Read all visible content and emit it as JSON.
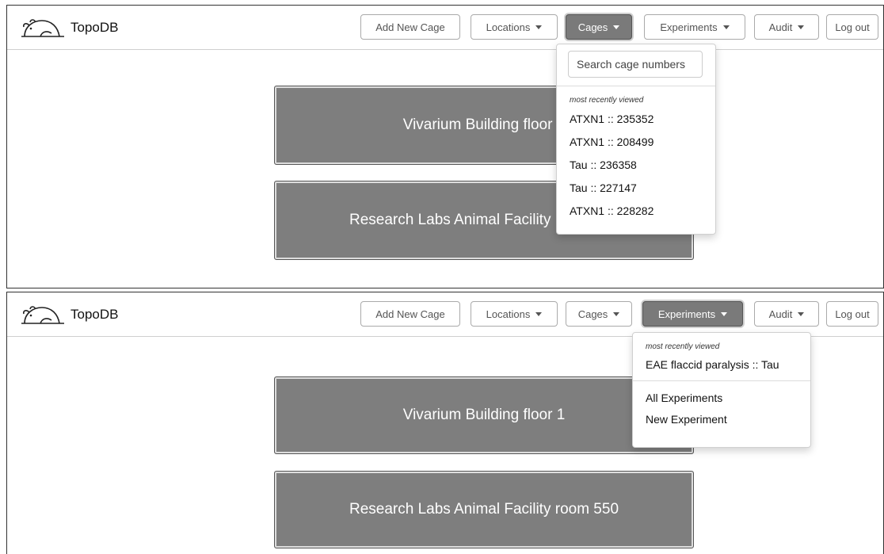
{
  "app": {
    "brand": "TopoDB"
  },
  "nav": {
    "add_new_cage": "Add New Cage",
    "locations": "Locations",
    "cages": "Cages",
    "experiments": "Experiments",
    "audit": "Audit",
    "log_out": "Log out"
  },
  "panel1": {
    "locations": [
      "Vivarium Building floor 1",
      "Research Labs Animal Facility room 550"
    ],
    "cages_dropdown": {
      "search_placeholder": "Search cage numbers",
      "recent_header": "most recently viewed",
      "recent": [
        "ATXN1 :: 235352",
        "ATXN1 :: 208499",
        "Tau :: 236358",
        "Tau :: 227147",
        "ATXN1 :: 228282"
      ]
    }
  },
  "panel2": {
    "locations": [
      "Vivarium Building floor 1",
      "Research Labs Animal Facility room 550"
    ],
    "experiments_dropdown": {
      "recent_header": "most recently viewed",
      "recent": [
        "EAE flaccid paralysis :: Tau"
      ],
      "actions": [
        "All Experiments",
        "New Experiment"
      ]
    }
  },
  "colors": {
    "active_button": "#7a7a7a",
    "location_button": "#7e7e7e"
  }
}
